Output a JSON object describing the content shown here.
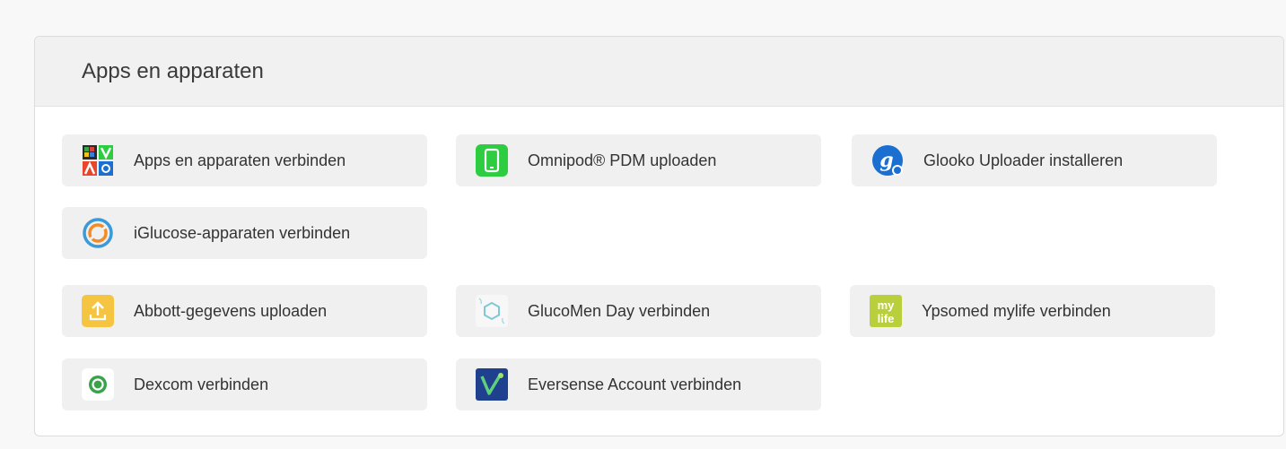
{
  "panel": {
    "title": "Apps en apparaten"
  },
  "tiles": {
    "apps_devices": {
      "label": "Apps en apparaten verbinden",
      "icon": "apps-grid-icon"
    },
    "omnipod": {
      "label": "Omnipod® PDM uploaden",
      "icon": "phone-icon",
      "color": "#2ecc40"
    },
    "glooko": {
      "label": "Glooko Uploader installeren",
      "icon": "glooko-logo-icon",
      "color": "#1a6fd1"
    },
    "iglucose": {
      "label": "iGlucose-apparaten verbinden",
      "icon": "iglucose-logo-icon"
    },
    "abbott": {
      "label": "Abbott-gegevens uploaden",
      "icon": "upload-icon",
      "color": "#f5c542"
    },
    "glucomen": {
      "label": "GlucoMen Day verbinden",
      "icon": "glucomen-hexagon-icon"
    },
    "ypsomed": {
      "label": "Ypsomed mylife verbinden",
      "icon": "mylife-logo-icon",
      "color": "#b9cf3c"
    },
    "dexcom": {
      "label": "Dexcom verbinden",
      "icon": "dexcom-logo-icon",
      "color": "#3aa34a"
    },
    "eversense": {
      "label": "Eversense Account verbinden",
      "icon": "eversense-logo-icon",
      "color": "#1f3f8f"
    }
  }
}
